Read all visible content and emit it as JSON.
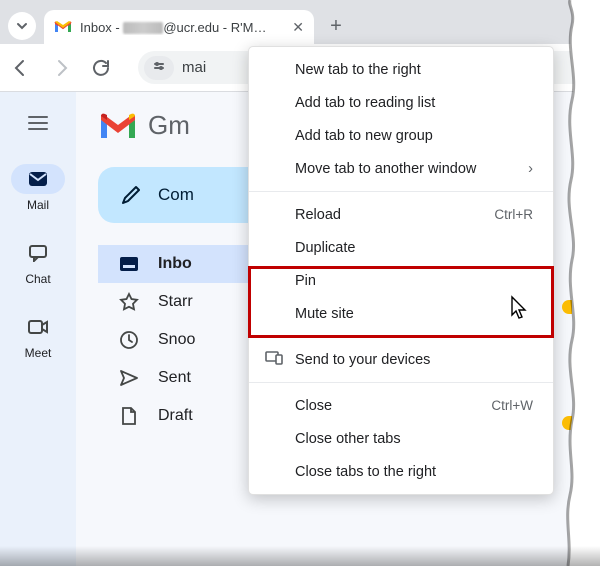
{
  "browser": {
    "tab": {
      "title_prefix": "Inbox - ",
      "title_domain_suffix": "@ucr.edu - R'M…",
      "favicon": "gmail",
      "close_label": "✕"
    },
    "new_tab": "+",
    "back": "←",
    "forward": "→",
    "reload": "⟳",
    "omnibox_text": "mai"
  },
  "gmail": {
    "product_name": "Gm",
    "nav": [
      {
        "icon": "mail",
        "label": "Mail",
        "active": true
      },
      {
        "icon": "chat",
        "label": "Chat",
        "active": false
      },
      {
        "icon": "meet",
        "label": "Meet",
        "active": false
      }
    ],
    "compose_label": "Com",
    "folders": [
      {
        "icon": "inbox",
        "label": "Inbo",
        "active": true
      },
      {
        "icon": "star",
        "label": "Starr"
      },
      {
        "icon": "clock",
        "label": "Snoo"
      },
      {
        "icon": "send",
        "label": "Sent"
      },
      {
        "icon": "file",
        "label": "Draft"
      }
    ]
  },
  "context_menu": {
    "items": [
      {
        "label": "New tab to the right"
      },
      {
        "label": "Add tab to reading list"
      },
      {
        "label": "Add tab to new group"
      },
      {
        "label": "Move tab to another window",
        "submenu": true
      },
      {
        "sep": true
      },
      {
        "label": "Reload",
        "shortcut": "Ctrl+R"
      },
      {
        "label": "Duplicate"
      },
      {
        "label": "Pin"
      },
      {
        "label": "Mute site"
      },
      {
        "sep": true
      },
      {
        "label": "Send to your devices",
        "icon": "devices"
      },
      {
        "sep": true
      },
      {
        "label": "Close",
        "shortcut": "Ctrl+W"
      },
      {
        "label": "Close other tabs"
      },
      {
        "label": "Close tabs to the right"
      }
    ]
  }
}
